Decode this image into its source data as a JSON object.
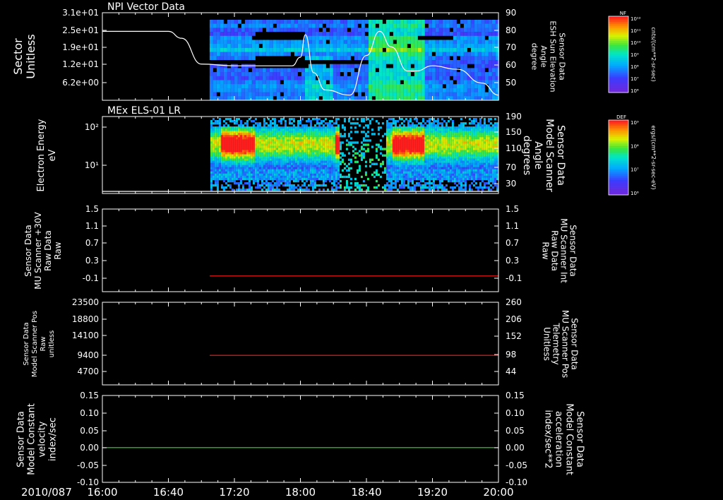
{
  "header": {
    "date_label": "2010/087"
  },
  "x_ticks": [
    "16:00",
    "16:40",
    "17:20",
    "18:00",
    "18:40",
    "19:20",
    "20:00"
  ],
  "chart_data": [
    {
      "type": "heatmap",
      "title": "NPI Vector Data",
      "ylabel_left": [
        "Sector",
        "Unitless"
      ],
      "yticks_left": [
        "3.1e+01",
        "2.5e+01",
        "1.9e+01",
        "1.2e+01",
        "6.2e+00"
      ],
      "ylabel_right": [
        "Sensor Data",
        "ESH Sun Elevation",
        "Angle",
        "degree"
      ],
      "yticks_right": [
        "90",
        "80",
        "70",
        "60",
        "50"
      ],
      "ylim_right": [
        40,
        90
      ],
      "overlay_line": {
        "name": "ESH Sun Elevation Angle",
        "x": [
          "16:00",
          "16:40",
          "16:48",
          "17:00",
          "17:20",
          "17:40",
          "17:55",
          "18:00",
          "18:03",
          "18:08",
          "18:15",
          "18:30",
          "18:40",
          "18:48",
          "18:55",
          "19:05",
          "19:10",
          "19:20",
          "19:35",
          "19:50",
          "20:00"
        ],
        "y": [
          80,
          80,
          76,
          61,
          60,
          60,
          60,
          65,
          78,
          56,
          46,
          43,
          66,
          80,
          71,
          57,
          57,
          60,
          58,
          50,
          43
        ]
      },
      "colorbar": {
        "label": "NF",
        "units": "cnts/(cm**2-sr-sec)",
        "ticks": [
          "10¹²",
          "10¹¹",
          "10¹⁰",
          "10⁹",
          "10⁸",
          "10⁷",
          "10⁶"
        ]
      }
    },
    {
      "type": "heatmap",
      "title": "MEx ELS-01 LR",
      "ylabel_left": [
        "Electron Energy",
        "eV"
      ],
      "yticks_left": [
        "10²",
        "10¹"
      ],
      "ylabel_right": [
        "Sensor Data",
        "Model Scanner",
        "Angle",
        "degrees"
      ],
      "yticks_right": [
        "190",
        "150",
        "110",
        "70",
        "30"
      ],
      "overlay_line": {
        "name": "Model Scanner Angle",
        "x": [
          "16:00",
          "20:00"
        ],
        "y": [
          10,
          10
        ]
      },
      "colorbar": {
        "label": "DEF",
        "units": "ergs/(cm**2-sr-sec-eV)",
        "ticks": [
          "10⁹",
          "10⁸",
          "10⁷",
          "10⁶"
        ]
      }
    },
    {
      "type": "line",
      "ylabel_left": [
        "Sensor Data",
        "MU Scanner +30V",
        "Raw Data",
        "Raw"
      ],
      "yticks_left": [
        "1.5",
        "1.1",
        "0.7",
        "0.3",
        "-0.1"
      ],
      "ylabel_right": [
        "Sensor Data",
        "MU Scanner Int",
        "Raw Data",
        "Raw"
      ],
      "yticks_right": [
        "1.5",
        "1.1",
        "0.7",
        "0.3",
        "-0.1"
      ],
      "ylim": [
        -0.4,
        1.5
      ],
      "series": [
        {
          "x": [
            "17:05",
            "20:00"
          ],
          "y": [
            -0.04,
            -0.04
          ],
          "color": "#ff1a1a"
        }
      ]
    },
    {
      "type": "line",
      "ylabel_left": [
        "Sensor Data",
        "Model Scanner Pos",
        "Raw",
        "unitless"
      ],
      "yticks_left": [
        "23500",
        "18800",
        "14100",
        "9400",
        "4700"
      ],
      "ylabel_right": [
        "Sensor Data",
        "MU Scanner Pos",
        "Telemetry",
        "Unitless"
      ],
      "yticks_right": [
        "260",
        "206",
        "152",
        "98",
        "44"
      ],
      "ylim": [
        0,
        23500
      ],
      "series": [
        {
          "x": [
            "17:05",
            "20:00"
          ],
          "y": [
            8400,
            8400
          ],
          "color": "#ff1a1a"
        }
      ]
    },
    {
      "type": "line",
      "ylabel_left": [
        "Sensor Data",
        "Model Constant",
        "velocity",
        "index/sec"
      ],
      "yticks_left": [
        "0.15",
        "0.10",
        "0.05",
        "0.00",
        "-0.05",
        "-0.10"
      ],
      "ylabel_right": [
        "Sensor Data",
        "Model Constant",
        "acceleration",
        "index/sec**2"
      ],
      "yticks_right": [
        "0.15",
        "0.10",
        "0.05",
        "0.00",
        "-0.05",
        "-0.10"
      ],
      "ylim": [
        -0.1,
        0.15
      ],
      "series": [
        {
          "x": [
            "16:00",
            "20:00"
          ],
          "y": [
            0.0,
            0.0
          ],
          "color": "#33dd33"
        }
      ]
    }
  ]
}
